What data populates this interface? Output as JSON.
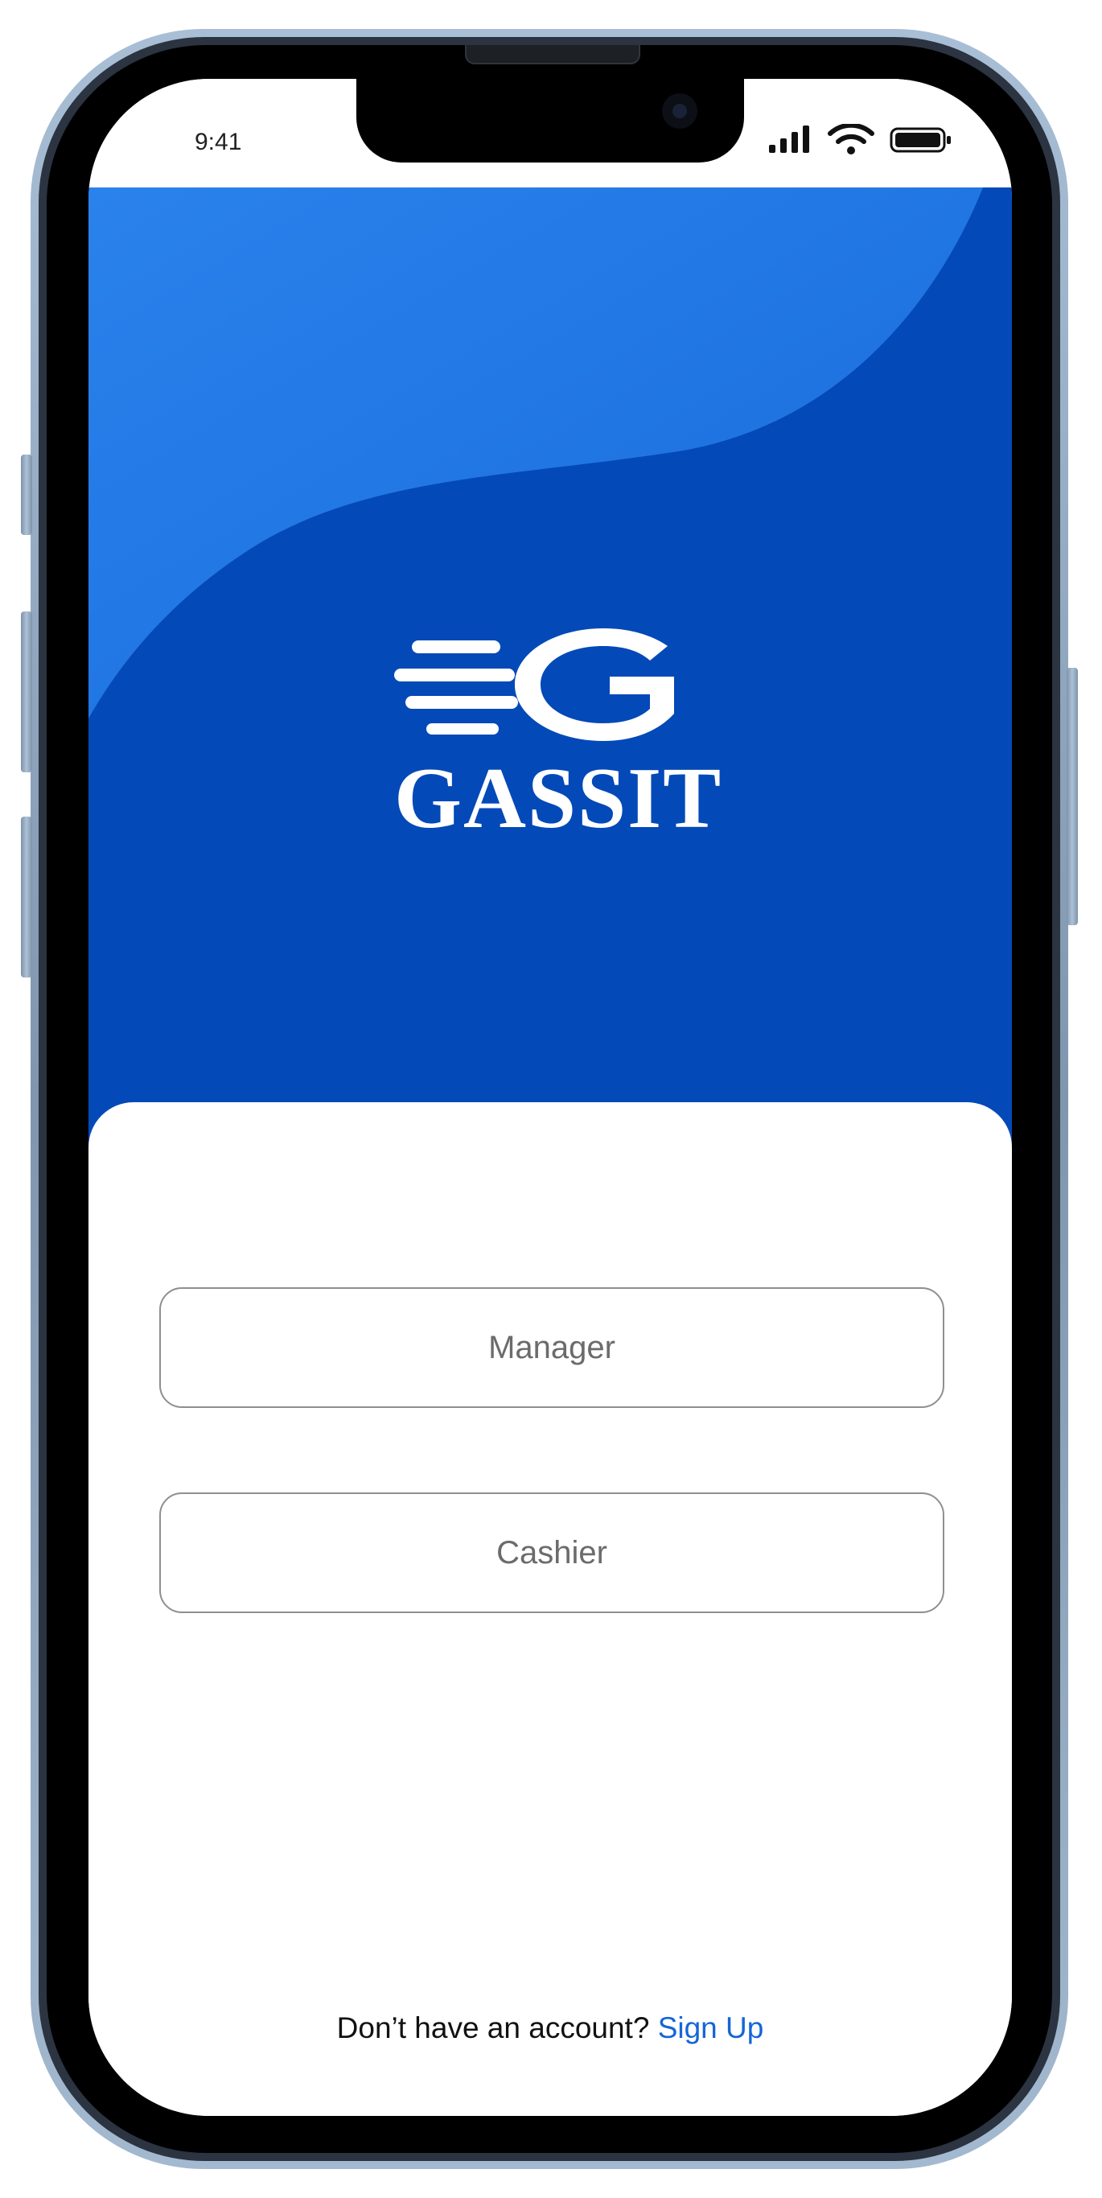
{
  "status_bar": {
    "time": "9:41"
  },
  "brand": {
    "name": "GASSIT"
  },
  "roles": [
    {
      "label": "Manager"
    },
    {
      "label": "Cashier"
    }
  ],
  "footer": {
    "prompt": "Don’t have an account?",
    "signup_label": "Sign Up"
  },
  "colors": {
    "header_blue": "#0449b8",
    "wave_light_blue": "#2176e6",
    "link_blue": "#1565d8",
    "button_border": "#8f8f8f"
  },
  "icons": [
    "cellular-signal-icon",
    "wifi-icon",
    "battery-icon",
    "gassit-logo-icon"
  ]
}
